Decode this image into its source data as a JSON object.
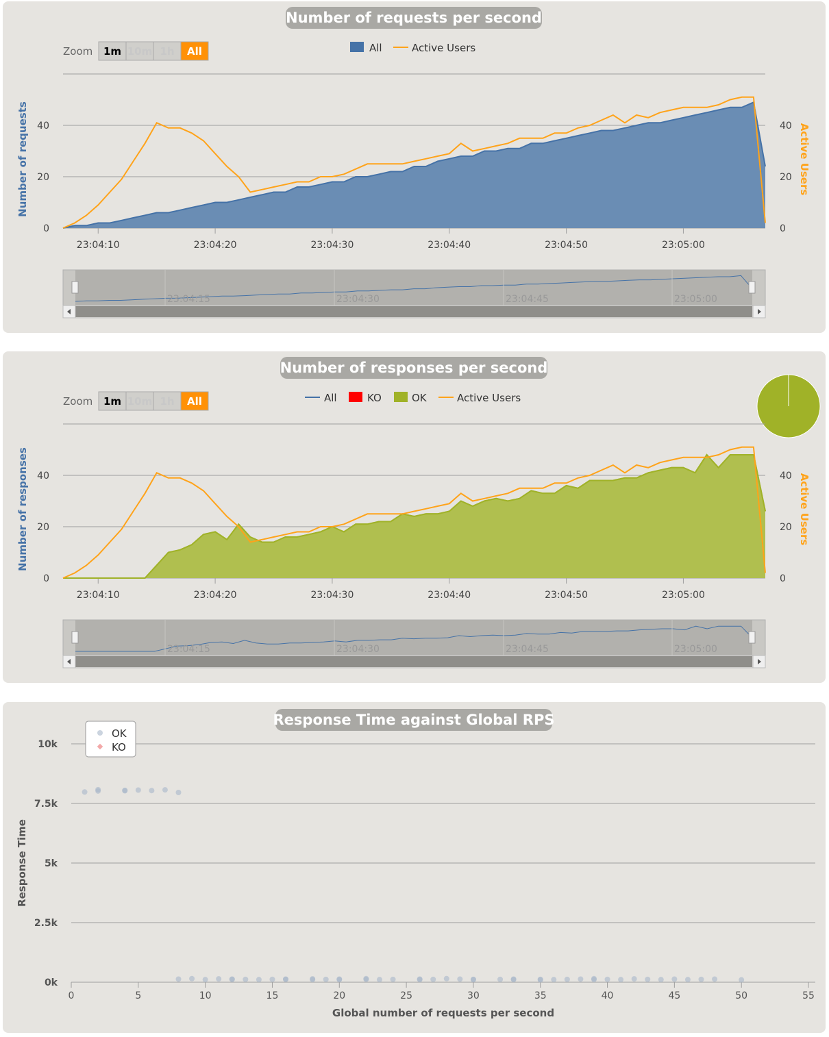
{
  "colors": {
    "panel_bg": "#e6e4e0",
    "title_pill": "#a9a8a4",
    "all_blue": "#4572a7",
    "all_fill": "#6a8db4",
    "ok_green": "#a0b228",
    "ok_fill": "#b0bf4f",
    "ko_red": "#ff0000",
    "active_orange": "#ffa31a",
    "zoom_orange": "#ff9106",
    "grid": "#9e9e9e"
  },
  "requests_chart": {
    "title": "Number of requests per second",
    "zoom_label": "Zoom",
    "zoom_buttons": [
      "1m",
      "10m",
      "1h",
      "All"
    ],
    "zoom_active": "All",
    "legend": [
      "All",
      "Active Users"
    ],
    "y_left_label": "Number of requests",
    "y_right_label": "Active Users",
    "nav_labels": [
      "23:04:15",
      "23:04:30",
      "23:04:45",
      "23:05:00"
    ]
  },
  "responses_chart": {
    "title": "Number of responses per second",
    "zoom_label": "Zoom",
    "zoom_buttons": [
      "1m",
      "10m",
      "1h",
      "All"
    ],
    "zoom_active": "All",
    "legend": [
      "All",
      "KO",
      "OK",
      "Active Users"
    ],
    "y_left_label": "Number of responses",
    "y_right_label": "Active Users",
    "nav_labels": [
      "23:04:15",
      "23:04:30",
      "23:04:45",
      "23:05:00"
    ],
    "pie": {
      "OK": 100,
      "KO": 0
    }
  },
  "scatter_chart": {
    "title": "Response Time against Global RPS",
    "legend": [
      "OK",
      "KO"
    ],
    "x_label": "Global number of requests per second",
    "y_label": "Response Time"
  },
  "chart_data": [
    {
      "type": "area",
      "title": "Number of requests per second",
      "x_ticks": [
        "23:04:10",
        "23:04:20",
        "23:04:30",
        "23:04:40",
        "23:04:50",
        "23:05:00"
      ],
      "x_range_seconds": [
        "23:04:07",
        "23:05:07"
      ],
      "y_left_ticks": [
        0,
        20,
        40
      ],
      "y_left_range": [
        0,
        60
      ],
      "y_right_ticks": [
        0,
        20,
        40
      ],
      "y_right_range": [
        0,
        60
      ],
      "x": [
        "23:04:07",
        "23:04:08",
        "23:04:09",
        "23:04:10",
        "23:04:11",
        "23:04:12",
        "23:04:13",
        "23:04:14",
        "23:04:15",
        "23:04:16",
        "23:04:17",
        "23:04:18",
        "23:04:19",
        "23:04:20",
        "23:04:21",
        "23:04:22",
        "23:04:23",
        "23:04:24",
        "23:04:25",
        "23:04:26",
        "23:04:27",
        "23:04:28",
        "23:04:29",
        "23:04:30",
        "23:04:31",
        "23:04:32",
        "23:04:33",
        "23:04:34",
        "23:04:35",
        "23:04:36",
        "23:04:37",
        "23:04:38",
        "23:04:39",
        "23:04:40",
        "23:04:41",
        "23:04:42",
        "23:04:43",
        "23:04:44",
        "23:04:45",
        "23:04:46",
        "23:04:47",
        "23:04:48",
        "23:04:49",
        "23:04:50",
        "23:04:51",
        "23:04:52",
        "23:04:53",
        "23:04:54",
        "23:04:55",
        "23:04:56",
        "23:04:57",
        "23:04:58",
        "23:04:59",
        "23:05:00",
        "23:05:01",
        "23:05:02",
        "23:05:03",
        "23:05:04",
        "23:05:05",
        "23:05:06",
        "23:05:07"
      ],
      "series": [
        {
          "name": "All",
          "values": [
            0,
            1,
            1,
            2,
            2,
            3,
            4,
            5,
            6,
            6,
            7,
            8,
            9,
            10,
            10,
            11,
            12,
            13,
            14,
            14,
            16,
            16,
            17,
            18,
            18,
            20,
            20,
            21,
            22,
            22,
            24,
            24,
            26,
            27,
            28,
            28,
            30,
            30,
            31,
            31,
            33,
            33,
            34,
            35,
            36,
            37,
            38,
            38,
            39,
            40,
            41,
            41,
            42,
            43,
            44,
            45,
            46,
            47,
            47,
            49,
            24
          ]
        },
        {
          "name": "Active Users",
          "values": [
            0,
            2,
            5,
            9,
            14,
            19,
            26,
            33,
            41,
            39,
            39,
            37,
            34,
            29,
            24,
            20,
            14,
            15,
            16,
            17,
            18,
            18,
            20,
            20,
            21,
            23,
            25,
            25,
            25,
            25,
            26,
            27,
            28,
            29,
            33,
            30,
            31,
            32,
            33,
            35,
            35,
            35,
            37,
            37,
            39,
            40,
            42,
            44,
            41,
            44,
            43,
            45,
            46,
            47,
            47,
            47,
            48,
            50,
            51,
            51,
            2
          ]
        }
      ]
    },
    {
      "type": "area",
      "title": "Number of responses per second",
      "x_ticks": [
        "23:04:10",
        "23:04:20",
        "23:04:30",
        "23:04:40",
        "23:04:50",
        "23:05:00"
      ],
      "x_range_seconds": [
        "23:04:07",
        "23:05:07"
      ],
      "y_left_ticks": [
        0,
        20,
        40
      ],
      "y_left_range": [
        0,
        60
      ],
      "y_right_ticks": [
        0,
        20,
        40
      ],
      "y_right_range": [
        0,
        60
      ],
      "x": [
        "23:04:07",
        "23:04:08",
        "23:04:09",
        "23:04:10",
        "23:04:11",
        "23:04:12",
        "23:04:13",
        "23:04:14",
        "23:04:15",
        "23:04:16",
        "23:04:17",
        "23:04:18",
        "23:04:19",
        "23:04:20",
        "23:04:21",
        "23:04:22",
        "23:04:23",
        "23:04:24",
        "23:04:25",
        "23:04:26",
        "23:04:27",
        "23:04:28",
        "23:04:29",
        "23:04:30",
        "23:04:31",
        "23:04:32",
        "23:04:33",
        "23:04:34",
        "23:04:35",
        "23:04:36",
        "23:04:37",
        "23:04:38",
        "23:04:39",
        "23:04:40",
        "23:04:41",
        "23:04:42",
        "23:04:43",
        "23:04:44",
        "23:04:45",
        "23:04:46",
        "23:04:47",
        "23:04:48",
        "23:04:49",
        "23:04:50",
        "23:04:51",
        "23:04:52",
        "23:04:53",
        "23:04:54",
        "23:04:55",
        "23:04:56",
        "23:04:57",
        "23:04:58",
        "23:04:59",
        "23:05:00",
        "23:05:01",
        "23:05:02",
        "23:05:03",
        "23:05:04",
        "23:05:05",
        "23:05:06",
        "23:05:07"
      ],
      "series": [
        {
          "name": "All",
          "values": [
            0,
            0,
            0,
            0,
            0,
            0,
            0,
            0,
            5,
            10,
            11,
            13,
            17,
            18,
            15,
            21,
            16,
            14,
            14,
            16,
            16,
            17,
            18,
            20,
            18,
            21,
            21,
            22,
            22,
            25,
            24,
            25,
            25,
            26,
            30,
            28,
            30,
            31,
            30,
            31,
            34,
            33,
            33,
            36,
            35,
            38,
            38,
            38,
            39,
            39,
            41,
            42,
            43,
            43,
            41,
            48,
            43,
            48,
            48,
            48,
            26
          ]
        },
        {
          "name": "KO",
          "values": [
            0,
            0,
            0,
            0,
            0,
            0,
            0,
            0,
            0,
            0,
            0,
            0,
            0,
            0,
            0,
            0,
            0,
            0,
            0,
            0,
            0,
            0,
            0,
            0,
            0,
            0,
            0,
            0,
            0,
            0,
            0,
            0,
            0,
            0,
            0,
            0,
            0,
            0,
            0,
            0,
            0,
            0,
            0,
            0,
            0,
            0,
            0,
            0,
            0,
            0,
            0,
            0,
            0,
            0,
            0,
            0,
            0,
            0,
            0,
            0,
            0
          ]
        },
        {
          "name": "OK",
          "values": [
            0,
            0,
            0,
            0,
            0,
            0,
            0,
            0,
            5,
            10,
            11,
            13,
            17,
            18,
            15,
            21,
            16,
            14,
            14,
            16,
            16,
            17,
            18,
            20,
            18,
            21,
            21,
            22,
            22,
            25,
            24,
            25,
            25,
            26,
            30,
            28,
            30,
            31,
            30,
            31,
            34,
            33,
            33,
            36,
            35,
            38,
            38,
            38,
            39,
            39,
            41,
            42,
            43,
            43,
            41,
            48,
            43,
            48,
            48,
            48,
            26
          ]
        },
        {
          "name": "Active Users",
          "values": [
            0,
            2,
            5,
            9,
            14,
            19,
            26,
            33,
            41,
            39,
            39,
            37,
            34,
            29,
            24,
            20,
            14,
            15,
            16,
            17,
            18,
            18,
            20,
            20,
            21,
            23,
            25,
            25,
            25,
            25,
            26,
            27,
            28,
            29,
            33,
            30,
            31,
            32,
            33,
            35,
            35,
            35,
            37,
            37,
            39,
            40,
            42,
            44,
            41,
            44,
            43,
            45,
            46,
            47,
            47,
            47,
            48,
            50,
            51,
            51,
            2
          ]
        }
      ]
    },
    {
      "type": "scatter",
      "title": "Response Time against Global RPS",
      "xlabel": "Global number of requests per second",
      "ylabel": "Response Time",
      "x_ticks": [
        0,
        5,
        10,
        15,
        20,
        25,
        30,
        35,
        40,
        45,
        50,
        55
      ],
      "x_range": [
        0,
        55
      ],
      "y_ticks": [
        "0k",
        "2.5k",
        "5k",
        "7.5k",
        "10k"
      ],
      "y_range": [
        0,
        10000
      ],
      "series": [
        {
          "name": "OK",
          "points": [
            [
              1,
              7980
            ],
            [
              2,
              8020
            ],
            [
              2,
              8080
            ],
            [
              4,
              8030
            ],
            [
              4,
              8050
            ],
            [
              5,
              8060
            ],
            [
              6,
              8040
            ],
            [
              7,
              8070
            ],
            [
              8,
              7960
            ],
            [
              8,
              130
            ],
            [
              9,
              150
            ],
            [
              10,
              110
            ],
            [
              11,
              140
            ],
            [
              12,
              120
            ],
            [
              12,
              130
            ],
            [
              13,
              120
            ],
            [
              14,
              110
            ],
            [
              15,
              120
            ],
            [
              16,
              130
            ],
            [
              16,
              120
            ],
            [
              18,
              140
            ],
            [
              18,
              110
            ],
            [
              19,
              120
            ],
            [
              20,
              110
            ],
            [
              20,
              130
            ],
            [
              22,
              150
            ],
            [
              22,
              120
            ],
            [
              23,
              110
            ],
            [
              24,
              120
            ],
            [
              26,
              130
            ],
            [
              26,
              110
            ],
            [
              27,
              120
            ],
            [
              28,
              150
            ],
            [
              29,
              130
            ],
            [
              30,
              110
            ],
            [
              30,
              120
            ],
            [
              32,
              120
            ],
            [
              33,
              110
            ],
            [
              33,
              130
            ],
            [
              35,
              120
            ],
            [
              35,
              100
            ],
            [
              36,
              110
            ],
            [
              37,
              120
            ],
            [
              38,
              130
            ],
            [
              39,
              110
            ],
            [
              39,
              150
            ],
            [
              40,
              120
            ],
            [
              41,
              110
            ],
            [
              42,
              140
            ],
            [
              43,
              120
            ],
            [
              44,
              110
            ],
            [
              45,
              130
            ],
            [
              46,
              110
            ],
            [
              47,
              120
            ],
            [
              48,
              130
            ],
            [
              50,
              100
            ]
          ]
        },
        {
          "name": "KO",
          "points": []
        }
      ]
    }
  ]
}
